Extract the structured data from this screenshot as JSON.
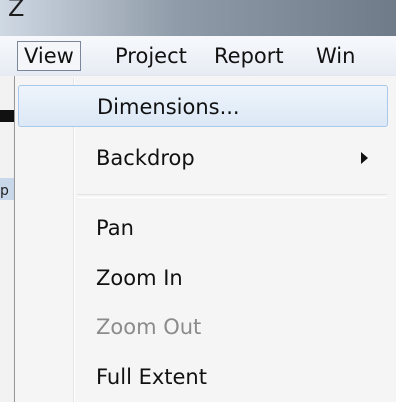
{
  "window": {
    "title_fragment": "Z"
  },
  "menubar": {
    "items": [
      "View",
      "Project",
      "Report",
      "Win"
    ]
  },
  "view_menu": {
    "items": [
      {
        "label": "Dimensions...",
        "state": "highlighted"
      },
      {
        "label": "Backdrop",
        "has_submenu": true
      },
      {
        "label": "Pan"
      },
      {
        "label": "Zoom In"
      },
      {
        "label": "Zoom Out",
        "state": "disabled"
      },
      {
        "label": "Full Extent"
      }
    ]
  },
  "left_edge_glyph": "p"
}
